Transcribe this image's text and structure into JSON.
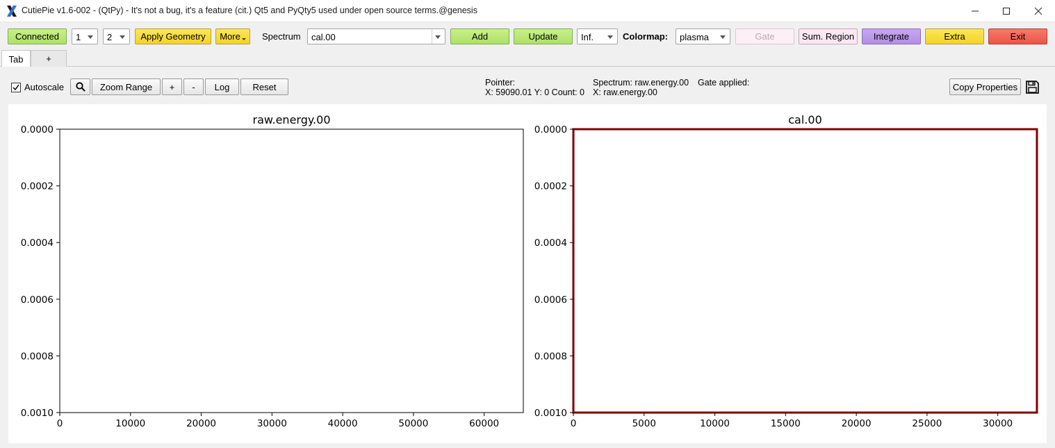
{
  "window": {
    "title": "CutiePie v1.6-002 - (QtPy) - It's not a bug, it's a feature (cit.) Qt5 and PyQty5 used under open source terms.@genesis",
    "logo_icon": "x-logo-icon"
  },
  "toolbar": {
    "connected_label": "Connected",
    "rows_value": "1",
    "cols_value": "2",
    "apply_geometry_label": "Apply Geometry",
    "more_label": "More",
    "spectrum_label": "Spectrum",
    "spectrum_value": "cal.00",
    "add_label": "Add",
    "update_label": "Update",
    "inf_value": "Inf.",
    "colormap_label": "Colormap:",
    "colormap_value": "plasma",
    "gate_label": "Gate",
    "sum_region_label": "Sum. Region",
    "integrate_label": "Integrate",
    "extra_label": "Extra",
    "exit_label": "Exit"
  },
  "tabs": [
    {
      "label": "Tab",
      "active": true
    },
    {
      "label": "+",
      "active": false
    }
  ],
  "plot_controls": {
    "autoscale_label": "Autoscale",
    "autoscale_checked": true,
    "zoom_range_label": "Zoom Range",
    "plus_label": "+",
    "minus_label": "-",
    "log_label": "Log",
    "reset_label": "Reset",
    "copy_properties_label": "Copy Properties"
  },
  "info": {
    "pointer_label": "Pointer:",
    "pointer_values": "X: 59090.01 Y: 0 Count: 0",
    "spectrum_line": "Spectrum: raw.energy.00",
    "spectrum_x": "X: raw.energy.00",
    "gate_applied": "Gate applied:"
  },
  "colors": {
    "selected_plot_border": "#800000",
    "green_button": "#aee06a",
    "yellow_button": "#f3d326",
    "purple_button": "#b38ee6",
    "red_button": "#ec5545"
  },
  "chart_data": [
    {
      "type": "line",
      "title": "raw.energy.00",
      "xlim": [
        0,
        65536
      ],
      "xticks": [
        "0",
        "10000",
        "20000",
        "30000",
        "40000",
        "50000",
        "60000"
      ],
      "xtick_values": [
        0,
        10000,
        20000,
        30000,
        40000,
        50000,
        60000
      ],
      "ylim": [
        0.0,
        0.001
      ],
      "yticks": [
        "0.0000",
        "0.0002",
        "0.0004",
        "0.0006",
        "0.0008",
        "0.0010"
      ],
      "ytick_values": [
        0.0,
        0.0002,
        0.0004,
        0.0006,
        0.0008,
        0.001
      ],
      "y_inverted": true,
      "series": [],
      "selected": false
    },
    {
      "type": "line",
      "title": "cal.00",
      "xlim": [
        0,
        32768
      ],
      "xticks": [
        "0",
        "5000",
        "10000",
        "15000",
        "20000",
        "25000",
        "30000"
      ],
      "xtick_values": [
        0,
        5000,
        10000,
        15000,
        20000,
        25000,
        30000
      ],
      "ylim": [
        0.0,
        0.001
      ],
      "yticks": [
        "0.0000",
        "0.0002",
        "0.0004",
        "0.0006",
        "0.0008",
        "0.0010"
      ],
      "ytick_values": [
        0.0,
        0.0002,
        0.0004,
        0.0006,
        0.0008,
        0.001
      ],
      "y_inverted": true,
      "series": [],
      "selected": true
    }
  ]
}
